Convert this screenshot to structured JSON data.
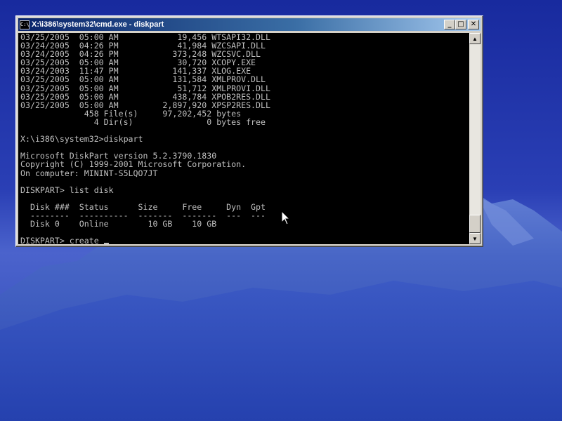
{
  "window": {
    "title": "X:\\i386\\system32\\cmd.exe - diskpart",
    "icon": "cmd-icon",
    "icon_text": "C:\\",
    "minimize_glyph": "_",
    "maximize_glyph": "□",
    "close_glyph": "✕"
  },
  "console": {
    "lines": [
      "03/25/2005  05:00 AM            19,456 WTSAPI32.DLL",
      "03/24/2005  04:26 PM            41,984 WZCSAPI.DLL",
      "03/24/2005  04:26 PM           373,248 WZCSVC.DLL",
      "03/25/2005  05:00 AM            30,720 XCOPY.EXE",
      "03/24/2003  11:47 PM           141,337 XLOG.EXE",
      "03/25/2005  05:00 AM           131,584 XMLPROV.DLL",
      "03/25/2005  05:00 AM            51,712 XMLPROVI.DLL",
      "03/25/2005  05:00 AM           438,784 XPOB2RES.DLL",
      "03/25/2005  05:00 AM         2,897,920 XPSP2RES.DLL",
      "             458 File(s)     97,202,452 bytes",
      "               4 Dir(s)               0 bytes free",
      "",
      "X:\\i386\\system32>diskpart",
      "",
      "Microsoft DiskPart version 5.2.3790.1830",
      "Copyright (C) 1999-2001 Microsoft Corporation.",
      "On computer: MININT-S5LQO7JT",
      "",
      "DISKPART> list disk",
      "",
      "  Disk ###  Status      Size     Free     Dyn  Gpt",
      "  --------  ----------  -------  -------  ---  ---",
      "  Disk 0    Online        10 GB    10 GB",
      "",
      "DISKPART> create "
    ]
  },
  "scrollbar": {
    "up_glyph": "▲",
    "down_glyph": "▼"
  },
  "colors": {
    "console_bg": "#000000",
    "console_fg": "#c0c0c0",
    "titlebar_start": "#0a246a",
    "titlebar_end": "#a6caf0",
    "desktop": "#2c43b8"
  }
}
